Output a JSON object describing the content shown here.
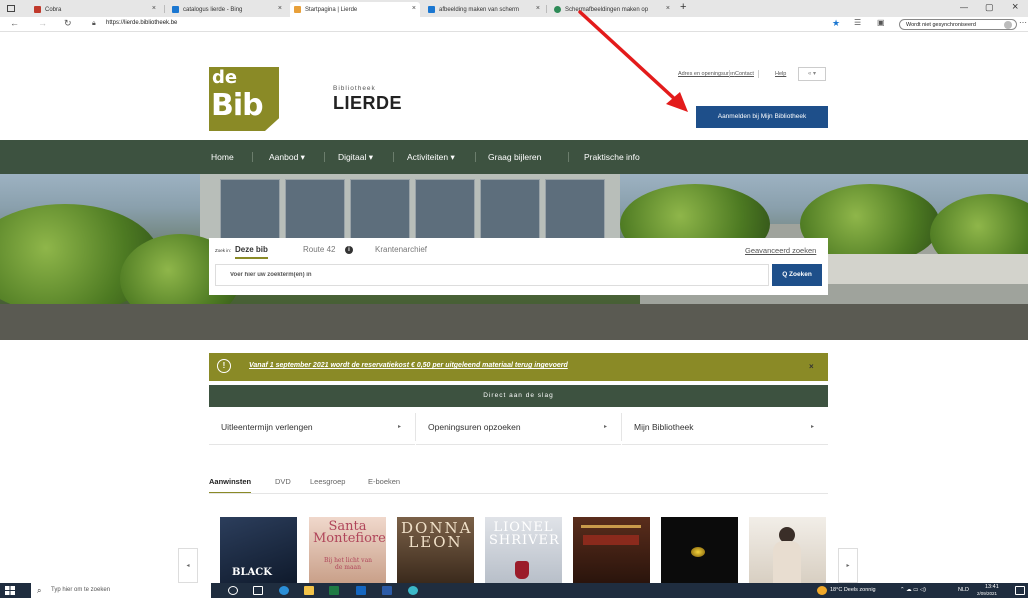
{
  "browser": {
    "tabs": [
      {
        "label": "Cobra",
        "color": "#c0392b"
      },
      {
        "label": "catalogus lierde - Bing",
        "color": "#1b77d1"
      },
      {
        "label": "Startpagina | Lierde",
        "color": "#e8a03a"
      },
      {
        "label": "afbeelding maken van scherm",
        "color": "#1b77d1"
      },
      {
        "label": "Schermafbeeldingen maken op",
        "color": "#2e8b57"
      }
    ],
    "new_tab": "+",
    "url": "https://lierde.bibliotheek.be",
    "sync_label": "Wordt niet gesynchroniseerd",
    "window_minimize": "—",
    "window_restore": "▢",
    "window_close": "×"
  },
  "header": {
    "logo_de": "de",
    "logo_bib": "Bib",
    "library_small": "Bibliotheek",
    "library_name": "LIERDE",
    "links": [
      "Adres en openingsuren",
      "Contact",
      "Help"
    ],
    "lang": "« ▾",
    "login": "Aanmelden bij Mijn Bibliotheek"
  },
  "nav": {
    "items": [
      "Home",
      "Aanbod ▾",
      "Digitaal ▾",
      "Activiteiten ▾",
      "Graag bijleren",
      "Praktische info"
    ]
  },
  "search": {
    "zoek_in": "Zoek in:",
    "tabs": [
      "Deze bib",
      "Route 42",
      "Krantenarchief"
    ],
    "info": "i",
    "advanced": "Geavanceerd zoeken",
    "placeholder": "Voer hier uw zoekterm(en) in",
    "button": "Q Zoeken"
  },
  "notice": {
    "icon": "!",
    "text": "Vanaf 1 september 2021 wordt de reservatiekost € 0,50 per uitgeleend materiaal terug ingevoerd",
    "close": "×"
  },
  "quick": {
    "header": "Direct aan de slag",
    "items": [
      "Uitleentermijn verlengen",
      "Openingsuren opzoeken",
      "Mijn Bibliotheek"
    ]
  },
  "collections": {
    "tabs": [
      "Aanwinsten",
      "DVD",
      "Leesgroep",
      "E-boeken"
    ]
  },
  "books": [
    {
      "title": "BLACK",
      "bg": "#1a2a40"
    },
    {
      "title": "Santa Montefiore",
      "subtitle": "Bij het licht van de maan",
      "bg": "#e8c9b8"
    },
    {
      "title": "DONNA LEON",
      "bg": "#5a4a3a"
    },
    {
      "title": "LIONEL SHRIVER",
      "bg": "#d9dbe0"
    },
    {
      "title": "",
      "bg": "#3a1e14"
    },
    {
      "title": "",
      "bg": "#0b0b0b"
    },
    {
      "title": "",
      "bg": "#e9e4dc"
    }
  ],
  "carousel": {
    "prev": "◂",
    "next": "▸"
  },
  "taskbar": {
    "search": "Typ hier om te zoeken",
    "weather": "18°C  Deels zonnig",
    "lang": "NLD",
    "time": "13:41",
    "date": "2/09/2021"
  },
  "colors": {
    "brand_olive": "#8a8a26",
    "nav_green": "#3d5240",
    "button_blue": "#1e4f8a",
    "arrow_red": "#e31b1b"
  }
}
